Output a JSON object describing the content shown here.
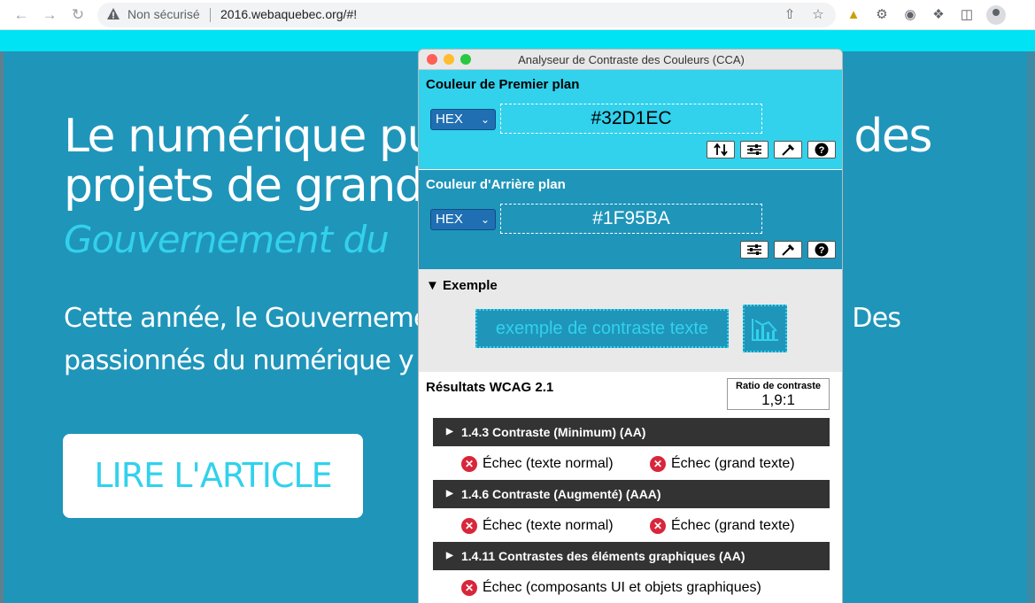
{
  "browser": {
    "security_label": "Non sécurisé",
    "url": "2016.webaquebec.org/#!"
  },
  "page": {
    "title": "Le numérique public et des projets de grande envergure : des",
    "title_line1": "Le numérique pub",
    "title_line1_right": "t des",
    "title_line2": "projets de grande",
    "subtitle": "Gouvernement du",
    "text_line1_left": "Cette année, le Gouverneme",
    "text_line1_right": "Q! Des",
    "text_line2_left": "passionnés du numérique y",
    "read_button": "LIRE L'ARTICLE"
  },
  "cca": {
    "window_title": "Analyseur de Contraste des Couleurs (CCA)",
    "foreground": {
      "label": "Couleur de Premier plan",
      "format": "HEX",
      "value": "#32D1EC"
    },
    "background": {
      "label": "Couleur d'Arrière plan",
      "format": "HEX",
      "value": "#1F95BA"
    },
    "example": {
      "label": "Exemple",
      "sample_text": "exemple de contraste texte"
    },
    "results": {
      "label": "Résultats WCAG 2.1",
      "ratio_label": "Ratio de contraste",
      "ratio_value": "1,9:1",
      "criteria": [
        {
          "title": "1.4.3 Contraste (Minimum) (AA)",
          "normal": "Échec (texte normal)",
          "large": "Échec (grand texte)"
        },
        {
          "title": "1.4.6 Contraste (Augmenté) (AAA)",
          "normal": "Échec (texte normal)",
          "large": "Échec (grand texte)"
        },
        {
          "title": "1.4.11 Contrastes des éléments graphiques (AA)",
          "graphics": "Échec (composants UI et objets graphiques)"
        }
      ]
    }
  },
  "colors": {
    "foreground": "#32d1ec",
    "background": "#1f95ba",
    "fail": "#d8263a"
  }
}
